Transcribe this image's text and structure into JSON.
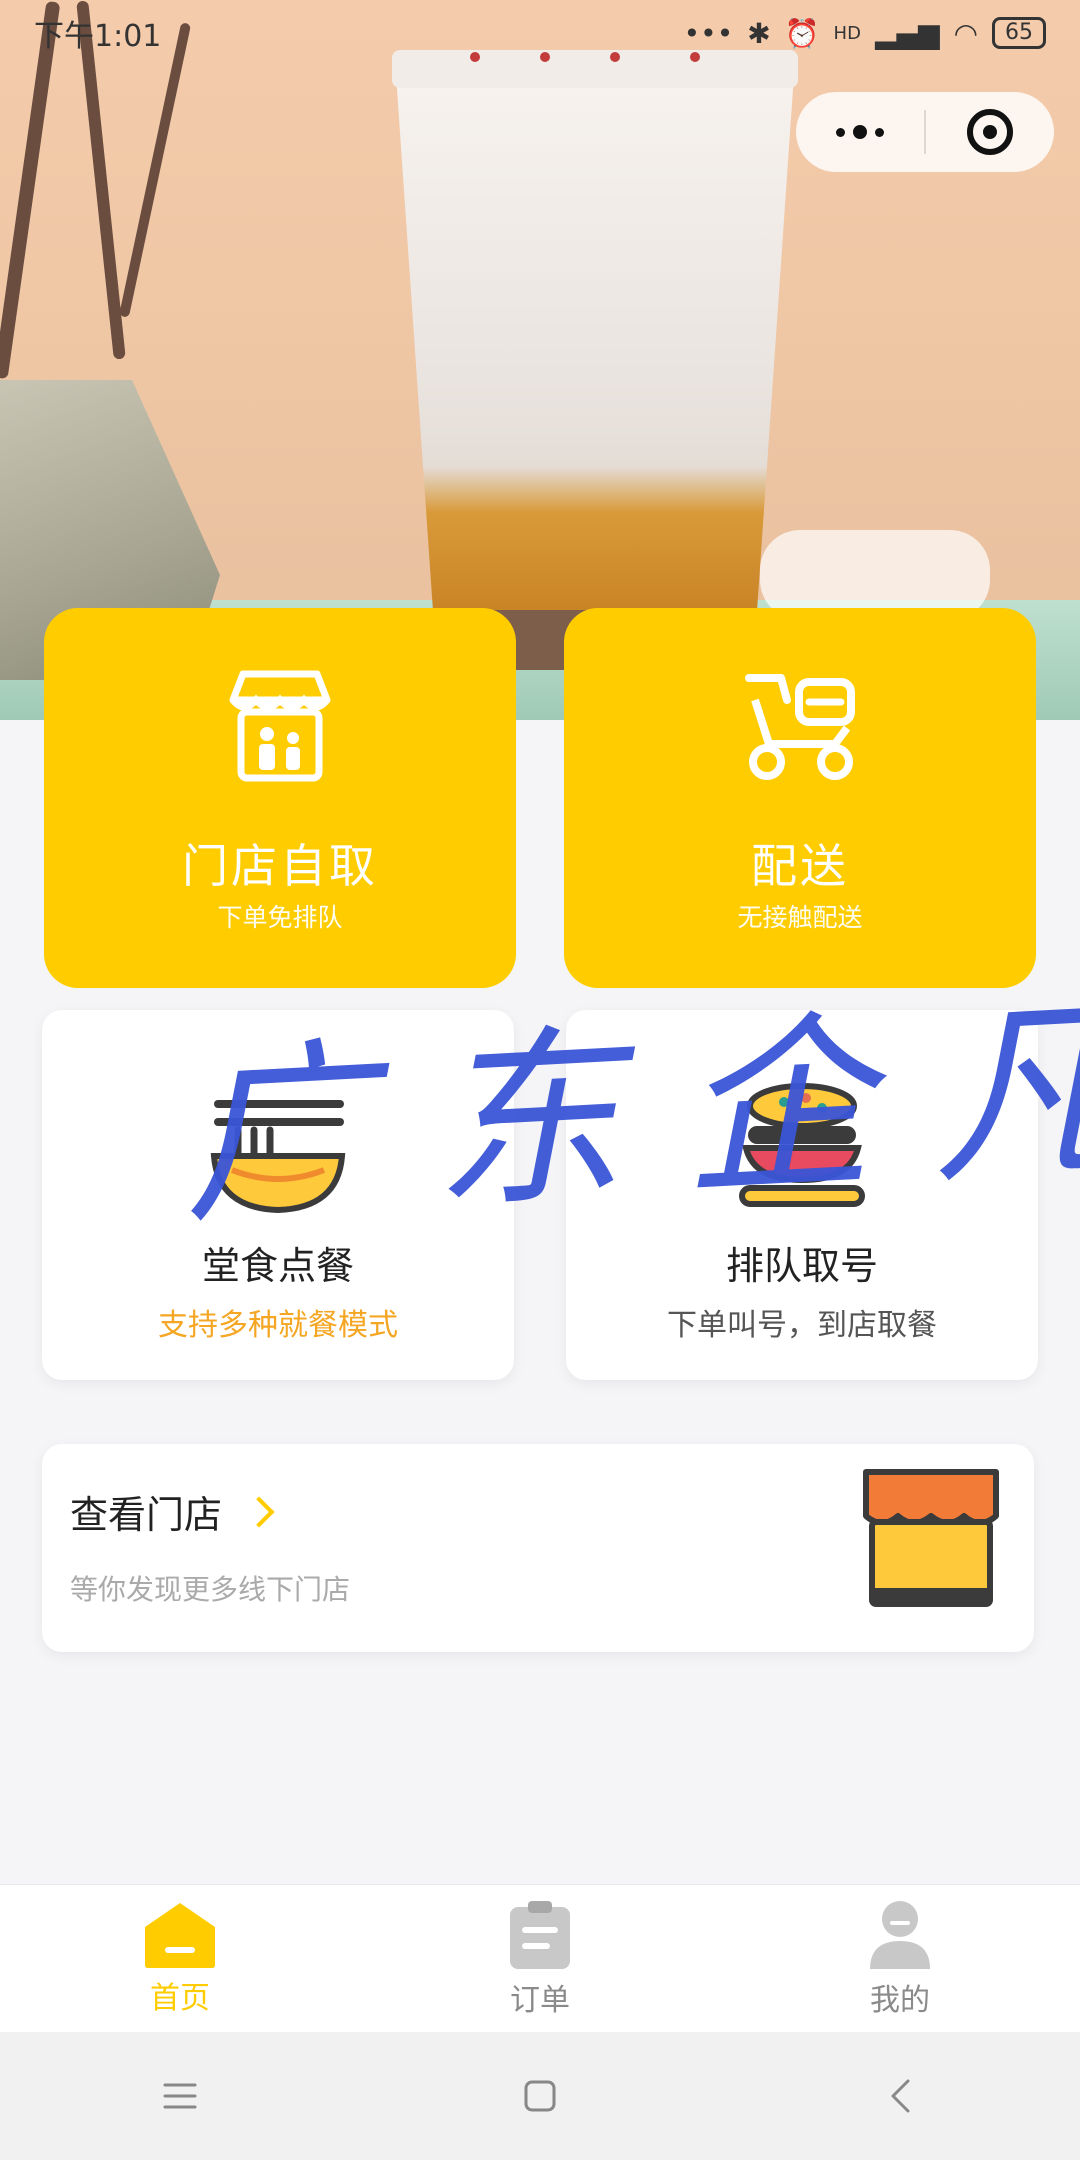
{
  "status_bar": {
    "time": "下午1:01",
    "signal_label": "HD",
    "battery": "65"
  },
  "capsule": {
    "more_icon": "more-dots-icon",
    "close_icon": "target-close-icon"
  },
  "service_cards": [
    {
      "title": "门店自取",
      "subtitle": "下单免排队",
      "icon": "storefront-icon"
    },
    {
      "title": "配送",
      "subtitle": "无接触配送",
      "icon": "scooter-icon"
    }
  ],
  "feature_cards": [
    {
      "title": "堂食点餐",
      "subtitle": "支持多种就餐模式",
      "icon": "noodle-bowl-icon"
    },
    {
      "title": "排队取号",
      "subtitle": "下单叫号，到店取餐",
      "icon": "stacked-plates-icon"
    }
  ],
  "store_card": {
    "title": "查看门店",
    "subtitle": "等你发现更多线下门店",
    "icon": "shop-awning-icon"
  },
  "watermark": [
    "广",
    "东",
    "企",
    "凡"
  ],
  "tabs": [
    {
      "label": "首页",
      "icon": "home-icon",
      "active": true
    },
    {
      "label": "订单",
      "icon": "order-clipboard-icon",
      "active": false
    },
    {
      "label": "我的",
      "icon": "profile-icon",
      "active": false
    }
  ],
  "colors": {
    "accent": "#ffcc00",
    "highlight_text": "#f5a623",
    "background": "#f5f5f7",
    "watermark": "#3a55d6"
  }
}
